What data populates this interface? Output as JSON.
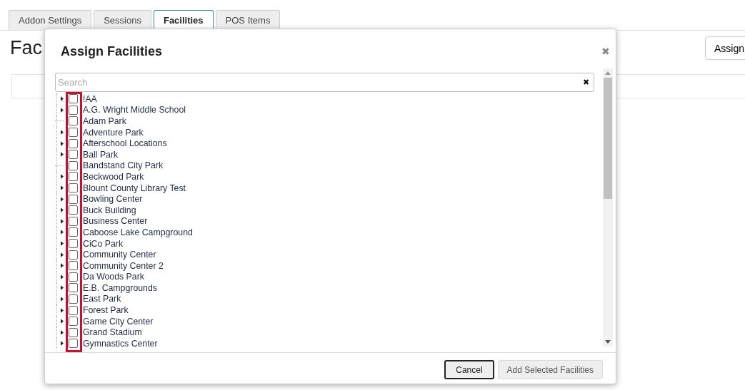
{
  "tabs": [
    {
      "label": "Addon Settings",
      "selected": false
    },
    {
      "label": "Sessions",
      "selected": false
    },
    {
      "label": "Facilities",
      "selected": true
    },
    {
      "label": "POS Items",
      "selected": false
    }
  ],
  "page": {
    "heading": "Fac",
    "assign_button": "Assign"
  },
  "dialog": {
    "title": "Assign Facilities",
    "close": "✖",
    "search": {
      "placeholder": "Search",
      "clear": "✖"
    },
    "facilities": [
      {
        "name": "!AA",
        "kind": "group",
        "checked": false
      },
      {
        "name": "A.G. Wright Middle School",
        "kind": "group",
        "checked": false
      },
      {
        "name": "Adam Park",
        "kind": "leaf",
        "checked": false
      },
      {
        "name": "Adventure Park",
        "kind": "group",
        "checked": false
      },
      {
        "name": "Afterschool Locations",
        "kind": "group",
        "checked": false
      },
      {
        "name": "Ball Park",
        "kind": "group",
        "checked": false
      },
      {
        "name": "Bandstand City Park",
        "kind": "leaf",
        "checked": false
      },
      {
        "name": "Beckwood Park",
        "kind": "group",
        "checked": false
      },
      {
        "name": "Blount County Library Test",
        "kind": "group",
        "checked": false
      },
      {
        "name": "Bowling Center",
        "kind": "group",
        "checked": false
      },
      {
        "name": "Buck Building",
        "kind": "group",
        "checked": false
      },
      {
        "name": "Business Center",
        "kind": "group",
        "checked": false
      },
      {
        "name": "Caboose Lake Campground",
        "kind": "group",
        "checked": false
      },
      {
        "name": "CiCo Park",
        "kind": "group",
        "checked": false
      },
      {
        "name": "Community Center",
        "kind": "group",
        "checked": false
      },
      {
        "name": "Community Center 2",
        "kind": "group",
        "checked": false
      },
      {
        "name": "Da Woods Park",
        "kind": "group",
        "checked": false
      },
      {
        "name": "E.B. Campgrounds",
        "kind": "group",
        "checked": false
      },
      {
        "name": "East Park",
        "kind": "group",
        "checked": false
      },
      {
        "name": "Forest Park",
        "kind": "group",
        "checked": false
      },
      {
        "name": "Game City Center",
        "kind": "group",
        "checked": false
      },
      {
        "name": "Grand Stadium",
        "kind": "group",
        "checked": false
      },
      {
        "name": "Gymnastics Center",
        "kind": "group",
        "checked": false
      }
    ],
    "buttons": [
      "Cancel",
      "Add Selected Facilities"
    ]
  }
}
